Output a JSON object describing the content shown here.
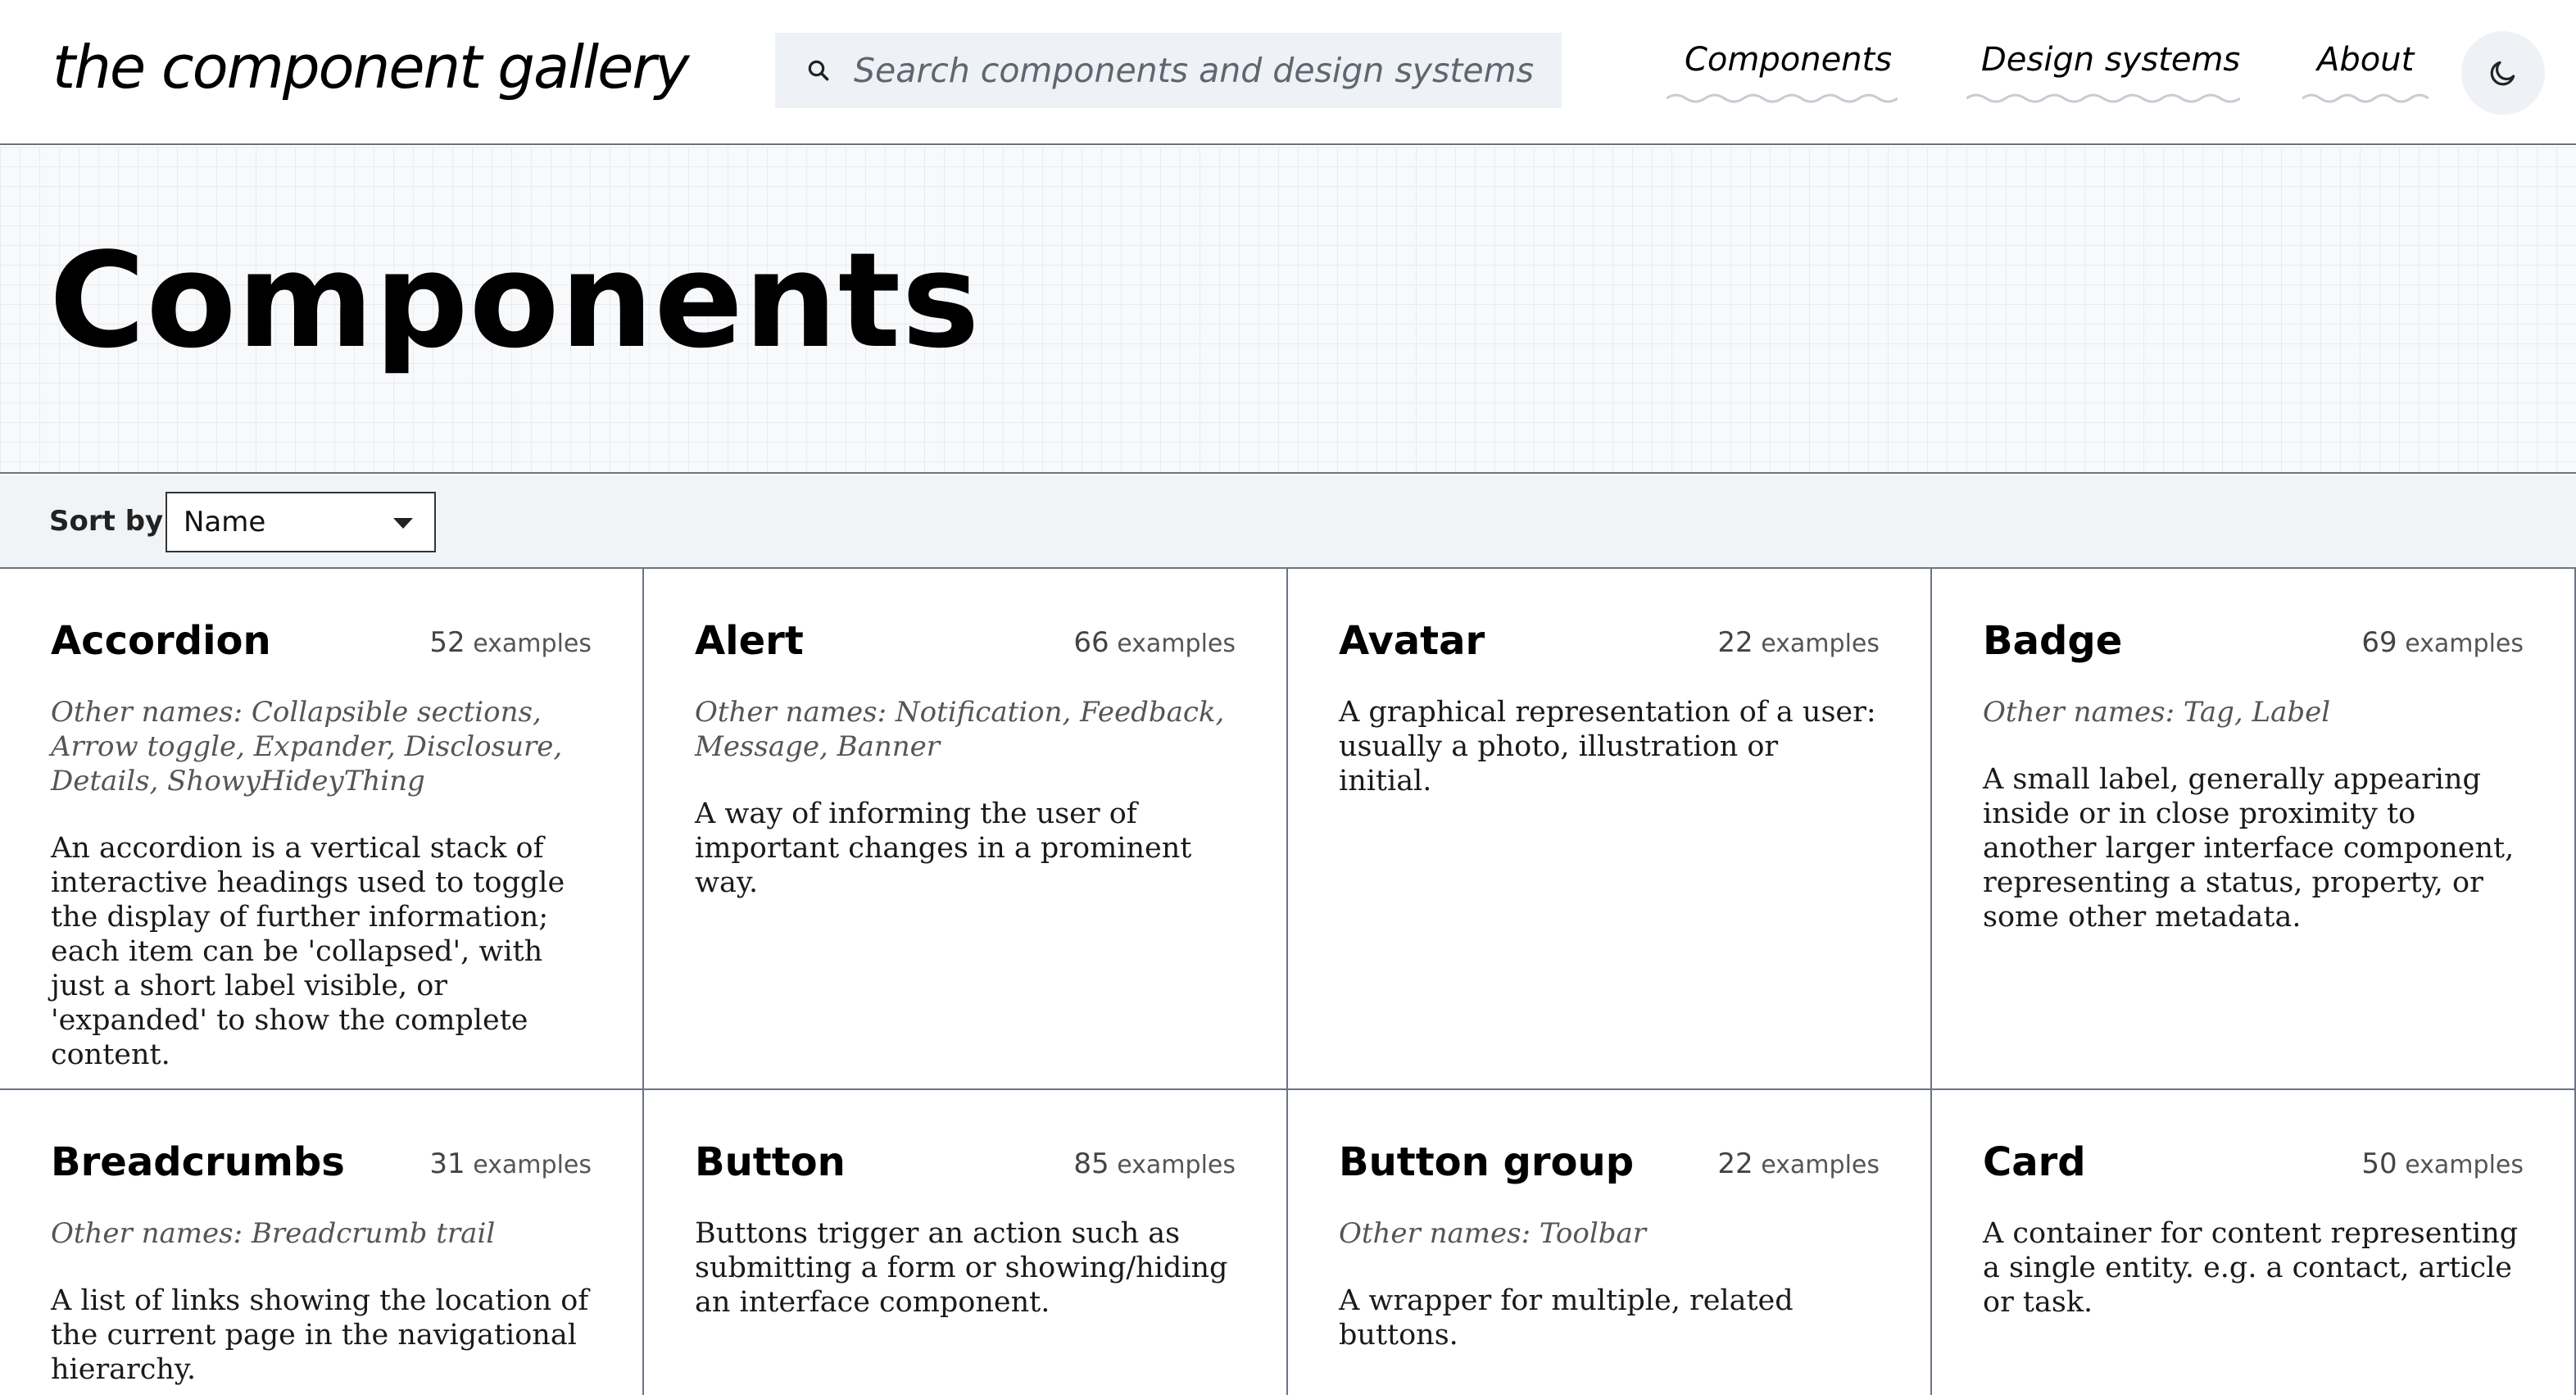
{
  "header": {
    "logo": "the component gallery",
    "search_placeholder": "Search components and design systems",
    "nav": [
      {
        "label": "Components"
      },
      {
        "label": "Design systems"
      },
      {
        "label": "About"
      }
    ]
  },
  "hero": {
    "title": "Components"
  },
  "sort": {
    "label": "Sort by",
    "selected": "Name"
  },
  "cards": [
    {
      "title": "Accordion",
      "count": "52",
      "count_label": "examples",
      "other_names": "Other names: Collapsible sections, Arrow toggle, Expander, Disclosure, Details, ShowyHideyThing",
      "description": "An accordion is a vertical stack of interactive headings used to toggle the display of further information; each item can be 'collapsed', with just a short label visible, or 'expanded' to show the complete content."
    },
    {
      "title": "Alert",
      "count": "66",
      "count_label": "examples",
      "other_names": "Other names: Notification, Feedback, Message, Banner",
      "description": "A way of informing the user of important changes in a prominent way."
    },
    {
      "title": "Avatar",
      "count": "22",
      "count_label": "examples",
      "other_names": "",
      "description": "A graphical representation of a user: usually a photo, illustration or initial."
    },
    {
      "title": "Badge",
      "count": "69",
      "count_label": "examples",
      "other_names": "Other names: Tag, Label",
      "description": "A small label, generally appearing inside or in close proximity to another larger interface component, representing a status, property, or some other metadata."
    },
    {
      "title": "Breadcrumbs",
      "count": "31",
      "count_label": "examples",
      "other_names": "Other names: Breadcrumb trail",
      "description": "A list of links showing the location of the current page in the navigational hierarchy."
    },
    {
      "title": "Button",
      "count": "85",
      "count_label": "examples",
      "other_names": "",
      "description": "Buttons trigger an action such as submitting a form or showing/hiding an interface component."
    },
    {
      "title": "Button group",
      "count": "22",
      "count_label": "examples",
      "other_names": "Other names: Toolbar",
      "description": "A wrapper for multiple, related buttons."
    },
    {
      "title": "Card",
      "count": "50",
      "count_label": "examples",
      "other_names": "",
      "description": "A container for content representing a single entity. e.g. a contact, article or task."
    }
  ]
}
